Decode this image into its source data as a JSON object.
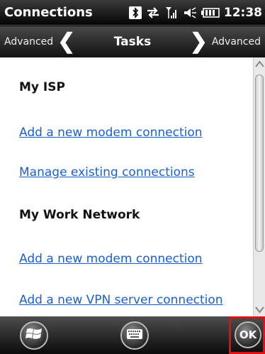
{
  "titlebar": {
    "title": "Connections",
    "clock": "12:38",
    "icons": [
      "bluetooth-icon",
      "sync-arrows-icon",
      "signal-strength-icon",
      "speaker-icon",
      "battery-icon"
    ]
  },
  "navbar": {
    "left_label": "Advanced",
    "center_title": "Tasks",
    "right_label": "Advanced"
  },
  "content": {
    "sections": [
      {
        "heading": "My ISP",
        "links": [
          "Add a new modem connection",
          "Manage existing connections"
        ]
      },
      {
        "heading": "My Work Network",
        "links": [
          "Add a new modem connection",
          "Add a new VPN server connection"
        ]
      }
    ]
  },
  "bottombar": {
    "ok_label": "OK",
    "icons": [
      "windows-start-icon",
      "keyboard-icon"
    ]
  },
  "colors": {
    "link": "#1a5fd6",
    "highlight_border": "#e01010"
  }
}
